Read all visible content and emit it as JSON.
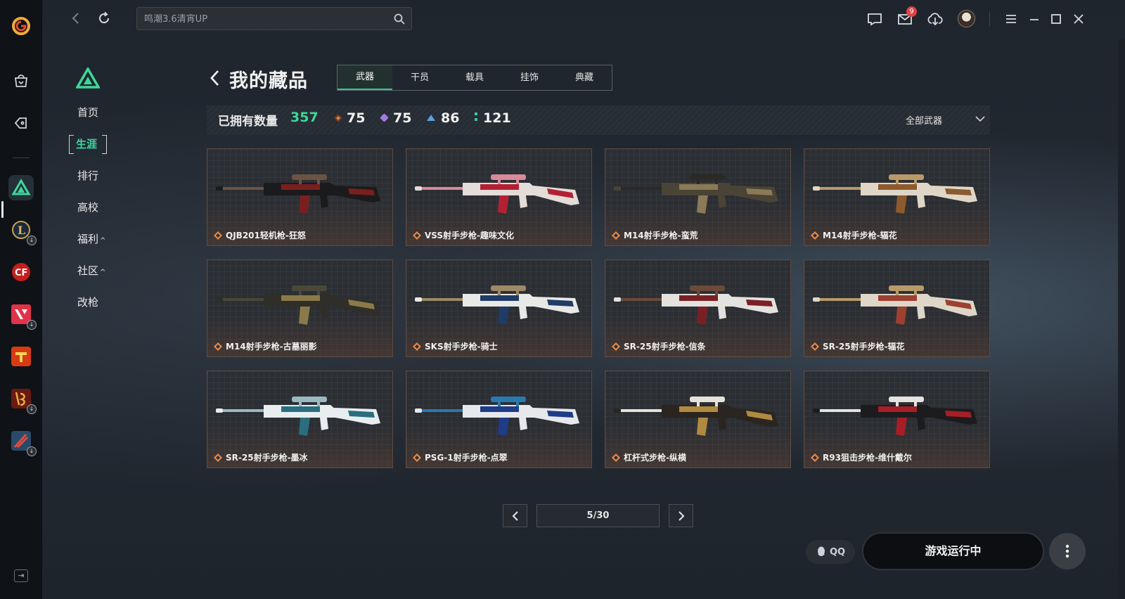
{
  "topbar": {
    "search_placeholder": "鸣潮3.6清宵UP",
    "mail_badge": "9"
  },
  "sidebar": {
    "items": [
      {
        "label": "首页"
      },
      {
        "label": "生涯"
      },
      {
        "label": "排行"
      },
      {
        "label": "高校"
      },
      {
        "label": "福利"
      },
      {
        "label": "社区"
      },
      {
        "label": "改枪"
      }
    ],
    "caret": "^"
  },
  "header": {
    "title": "我的藏品",
    "tabs": [
      "武器",
      "干员",
      "载具",
      "挂饰",
      "典藏"
    ],
    "active_tab": "武器"
  },
  "stats": {
    "owned_label": "已拥有数量",
    "owned_count": "357",
    "rarities": [
      {
        "count": "75",
        "color": "#e6884a"
      },
      {
        "count": "75",
        "color": "#a07ae0"
      },
      {
        "count": "86",
        "color": "#5a9fe0"
      },
      {
        "count": "121",
        "color": "#3ec79a"
      }
    ],
    "filter_label": "全部武器"
  },
  "items": [
    {
      "name": "QJB201轻机枪-狂怒",
      "palette": [
        "#1b1b1d",
        "#7a1f1f",
        "#6b5444"
      ]
    },
    {
      "name": "VSS射手步枪-趣味文化",
      "palette": [
        "#e3dcd8",
        "#b32034",
        "#d88a9a"
      ]
    },
    {
      "name": "M14射手步枪-蛮荒",
      "palette": [
        "#4a4436",
        "#8a7a56",
        "#2c2a24"
      ]
    },
    {
      "name": "M14射手步枪-辐花",
      "palette": [
        "#e0d6c8",
        "#8c5a2c",
        "#b89a6a"
      ]
    },
    {
      "name": "M14射手步枪-古墓丽影",
      "palette": [
        "#2f2e28",
        "#8a7a4a",
        "#4a4838"
      ]
    },
    {
      "name": "SKS射手步枪-骑士",
      "palette": [
        "#e8e8e6",
        "#1f3c66",
        "#9c8a66"
      ]
    },
    {
      "name": "SR-25射手步枪-信条",
      "palette": [
        "#e4e2de",
        "#7a2024",
        "#6b4a38"
      ]
    },
    {
      "name": "SR-25射手步枪-辐花",
      "palette": [
        "#ded6c8",
        "#9c4030",
        "#b89a6a"
      ]
    },
    {
      "name": "SR-25射手步枪-墨冰",
      "palette": [
        "#e8eef0",
        "#2a6e80",
        "#9ab8c0"
      ]
    },
    {
      "name": "PSG-1射手步枪-点翠",
      "palette": [
        "#e6e8ec",
        "#1e3c88",
        "#2a7ab0"
      ]
    },
    {
      "name": "杠杆式步枪-纵横",
      "palette": [
        "#2a2520",
        "#b08a40",
        "#e6e2da"
      ]
    },
    {
      "name": "R93狙击步枪-维什戴尔",
      "palette": [
        "#1c1c1e",
        "#a81e26",
        "#e6e2e0"
      ]
    }
  ],
  "pagination": {
    "display": "5/30"
  },
  "footer": {
    "qq_label": "QQ",
    "run_label": "游戏运行中"
  }
}
